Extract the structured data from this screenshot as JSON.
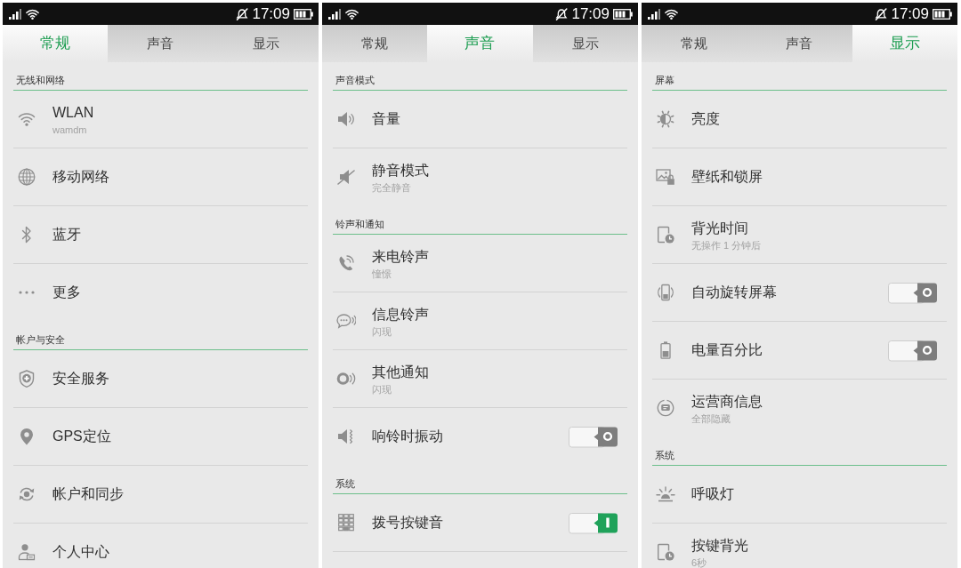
{
  "screens": [
    {
      "status_bar": {
        "time": "17:09"
      },
      "tabs": [
        {
          "label": "常规",
          "selected": true
        },
        {
          "label": "声音",
          "selected": false
        },
        {
          "label": "显示",
          "selected": false
        }
      ],
      "sections": [
        {
          "title": "无线和网络",
          "items": [
            {
              "kind": "plain",
              "title": "WLAN",
              "subtitle": "wamdm"
            },
            {
              "kind": "plain",
              "title": "移动网络"
            },
            {
              "kind": "plain",
              "title": "蓝牙"
            },
            {
              "kind": "plain",
              "title": "更多"
            }
          ]
        },
        {
          "title": "帐户与安全",
          "items": [
            {
              "kind": "plain",
              "title": "安全服务"
            },
            {
              "kind": "plain",
              "title": "GPS定位"
            },
            {
              "kind": "plain",
              "title": "帐户和同步"
            },
            {
              "kind": "plain",
              "title": "个人中心"
            }
          ]
        }
      ]
    },
    {
      "status_bar": {
        "time": "17:09"
      },
      "tabs": [
        {
          "label": "常规",
          "selected": false
        },
        {
          "label": "声音",
          "selected": true
        },
        {
          "label": "显示",
          "selected": false
        }
      ],
      "sections": [
        {
          "title": "声音模式",
          "items": [
            {
              "kind": "plain",
              "title": "音量"
            },
            {
              "kind": "plain",
              "title": "静音模式",
              "subtitle": "完全静音"
            }
          ]
        },
        {
          "title": "铃声和通知",
          "items": [
            {
              "kind": "plain",
              "title": "来电铃声",
              "subtitle": "憧憬"
            },
            {
              "kind": "plain",
              "title": "信息铃声",
              "subtitle": "闪现"
            },
            {
              "kind": "plain",
              "title": "其他通知",
              "subtitle": "闪现"
            },
            {
              "kind": "switch",
              "title": "响铃时振动",
              "on": false
            }
          ]
        },
        {
          "title": "系统",
          "items": [
            {
              "kind": "switch",
              "title": "拨号按键音",
              "on": true
            }
          ]
        }
      ]
    },
    {
      "status_bar": {
        "time": "17:09"
      },
      "tabs": [
        {
          "label": "常规",
          "selected": false
        },
        {
          "label": "声音",
          "selected": false
        },
        {
          "label": "显示",
          "selected": true
        }
      ],
      "sections": [
        {
          "title": "屏幕",
          "items": [
            {
              "kind": "plain",
              "title": "亮度"
            },
            {
              "kind": "plain",
              "title": "壁纸和锁屏"
            },
            {
              "kind": "plain",
              "title": "背光时间",
              "subtitle": "无操作 1 分钟后"
            },
            {
              "kind": "switch",
              "title": "自动旋转屏幕",
              "on": false
            },
            {
              "kind": "switch",
              "title": "电量百分比",
              "on": false
            },
            {
              "kind": "plain",
              "title": "运营商信息",
              "subtitle": "全部隐藏"
            }
          ]
        },
        {
          "title": "系统",
          "items": [
            {
              "kind": "plain",
              "title": "呼吸灯"
            },
            {
              "kind": "plain",
              "title": "按键背光",
              "subtitle": "6秒"
            }
          ]
        }
      ]
    }
  ]
}
